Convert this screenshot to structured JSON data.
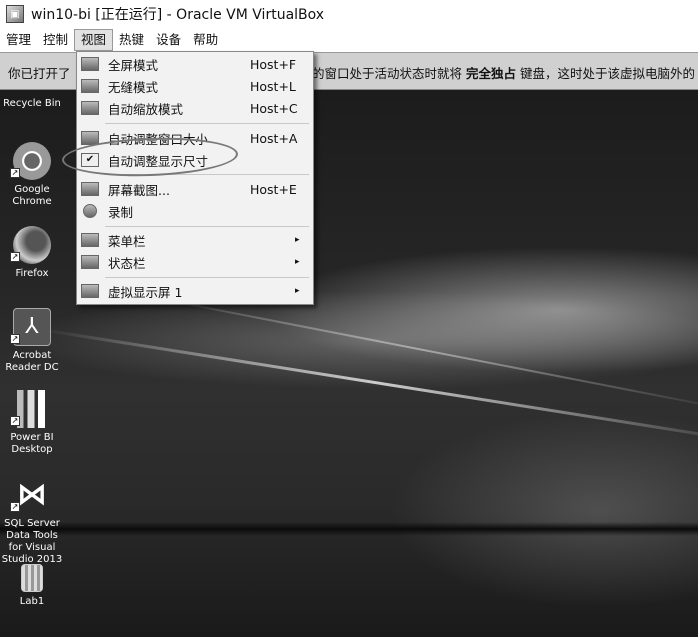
{
  "window": {
    "title": "win10-bi [正在运行] - Oracle VM VirtualBox"
  },
  "menubar": {
    "items": [
      "管理",
      "控制",
      "视图",
      "热键",
      "设备",
      "帮助"
    ]
  },
  "notification": {
    "left_text": "你已打开了",
    "right_text_a": "的窗口处于活动状态时就将",
    "right_bold": "完全独占",
    "right_text_b": "键盘，这时处于该虚拟电脑外的"
  },
  "view_menu": {
    "items": [
      {
        "label": "全屏模式",
        "shortcut": "Host+F",
        "icon": "fullscreen-icon"
      },
      {
        "label": "无缝模式",
        "shortcut": "Host+L",
        "icon": "seamless-icon"
      },
      {
        "label": "自动缩放模式",
        "shortcut": "Host+C",
        "icon": "scale-icon"
      },
      {
        "label": "自动调整窗口大小",
        "shortcut": "Host+A",
        "icon": "resize-window-icon"
      },
      {
        "label": "自动调整显示尺寸",
        "shortcut": "",
        "icon": "checked-icon"
      },
      {
        "label": "屏幕截图...",
        "shortcut": "Host+E",
        "icon": "screenshot-icon"
      },
      {
        "label": "录制",
        "shortcut": "",
        "icon": "record-icon"
      },
      {
        "label": "菜单栏",
        "shortcut": "",
        "icon": "menubar-icon",
        "submenu": "▸"
      },
      {
        "label": "状态栏",
        "shortcut": "",
        "icon": "statusbar-icon",
        "submenu": "▸"
      },
      {
        "label": "虚拟显示屏 1",
        "shortcut": "",
        "icon": "virtual-screen-icon",
        "submenu": "▸"
      }
    ]
  },
  "desktop": {
    "icons": [
      {
        "label": "Recycle Bin",
        "icon": "recycle-bin-icon"
      },
      {
        "label": "Google Chrome",
        "icon": "chrome-icon"
      },
      {
        "label": "Firefox",
        "icon": "firefox-icon"
      },
      {
        "label": "Acrobat Reader DC",
        "icon": "acrobat-icon"
      },
      {
        "label": "Power BI Desktop",
        "icon": "powerbi-icon"
      },
      {
        "label": "SQL Server Data Tools for Visual Studio 2013",
        "icon": "visual-studio-icon"
      },
      {
        "label": "Lab1",
        "icon": "archive-icon"
      }
    ]
  }
}
